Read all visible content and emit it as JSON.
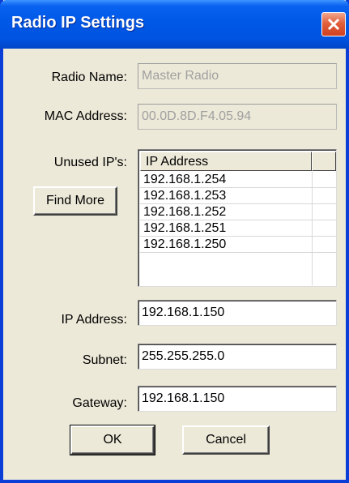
{
  "window": {
    "title": "Radio IP Settings",
    "close_icon": "close-icon"
  },
  "form": {
    "radio_name_label": "Radio Name:",
    "radio_name_value": "Master Radio",
    "mac_address_label": "MAC Address:",
    "mac_address_value": "00.0D.8D.F4.05.94",
    "unused_ips_label": "Unused IP's:",
    "find_more_label": "Find More",
    "ip_list": {
      "header": "IP Address",
      "rows": [
        "192.168.1.254",
        "192.168.1.253",
        "192.168.1.252",
        "192.168.1.251",
        "192.168.1.250"
      ]
    },
    "ip_address_label": "IP Address:",
    "ip_address_value": "192.168.1.150",
    "subnet_label": "Subnet:",
    "subnet_value": "255.255.255.0",
    "gateway_label": "Gateway:",
    "gateway_value": "192.168.1.150"
  },
  "buttons": {
    "ok_label": "OK",
    "cancel_label": "Cancel"
  },
  "colors": {
    "titlebar": "#0058e6",
    "close_button": "#e2603c",
    "dialog_bg": "#ece9d8"
  }
}
